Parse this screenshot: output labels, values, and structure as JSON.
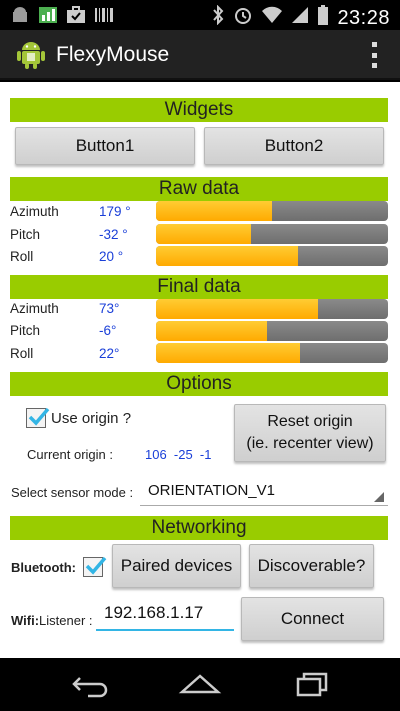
{
  "status_bar": {
    "time": "23:28",
    "icons": [
      "android-notif-icon",
      "signal-bars-notif-icon",
      "briefcase-notif-icon",
      "barcode-notif-icon",
      "bluetooth-icon",
      "alarm-icon",
      "wifi-icon",
      "cell-signal-icon",
      "battery-icon"
    ]
  },
  "app_bar": {
    "title": "FlexyMouse",
    "icon": "android-app-icon",
    "menu_icon": "overflow-menu-icon"
  },
  "widgets": {
    "header": "Widgets",
    "button1": "Button1",
    "button2": "Button2"
  },
  "raw_data": {
    "header": "Raw data",
    "rows": [
      {
        "label": "Azimuth",
        "value": "179 °",
        "fill": 0.5
      },
      {
        "label": "Pitch",
        "value": "-32 °",
        "fill": 0.41
      },
      {
        "label": "Roll",
        "value": "20 °",
        "fill": 0.61
      }
    ]
  },
  "final_data": {
    "header": "Final data",
    "rows": [
      {
        "label": "Azimuth",
        "value": "73°",
        "fill": 0.7
      },
      {
        "label": "Pitch",
        "value": "-6°",
        "fill": 0.48
      },
      {
        "label": "Roll",
        "value": "22°",
        "fill": 0.62
      }
    ]
  },
  "options": {
    "header": "Options",
    "use_origin_label": "Use origin ?",
    "use_origin_checked": true,
    "reset_origin_label": "Reset origin\n(ie. recenter view)",
    "current_origin_label": "Current origin :",
    "current_origin_values": "106  -25  -1",
    "sensor_mode_label": "Select sensor mode :",
    "sensor_mode_value": "ORIENTATION_V1"
  },
  "networking": {
    "header": "Networking",
    "bluetooth_label": "Bluetooth:",
    "bluetooth_checked": true,
    "paired_devices_label": "Paired devices",
    "discoverable_label": "Discoverable?",
    "wifi_label_bold": "Wifi:",
    "wifi_label": "Listener :",
    "ip_value": "192.168.1.17",
    "connect_label": "Connect"
  },
  "colors": {
    "section_header": "#99cc00",
    "bar_fill": "#ffaa00",
    "bar_track": "#777777",
    "value_text": "#1a3fd8",
    "input_underline": "#33b5e5"
  },
  "nav_bar": {
    "back_icon": "back-icon",
    "home_icon": "home-icon",
    "recents_icon": "recents-icon"
  }
}
